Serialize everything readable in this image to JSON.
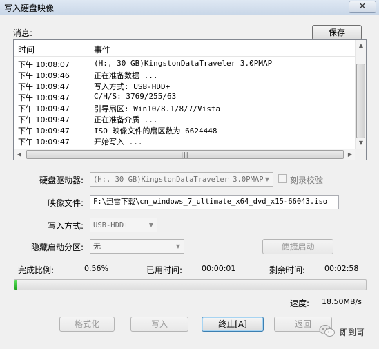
{
  "window": {
    "title": "写入硬盘映像",
    "close_symbol": "✕"
  },
  "messages": {
    "label": "消息:",
    "save_button": "保存",
    "columns": [
      "时间",
      "事件"
    ],
    "rows": [
      {
        "time": "下午 10:08:07",
        "event": "(H:, 30 GB)KingstonDataTraveler 3.0PMAP"
      },
      {
        "time": "下午 10:09:46",
        "event": "正在准备数据 ..."
      },
      {
        "time": "下午 10:09:47",
        "event": "写入方式: USB-HDD+"
      },
      {
        "time": "下午 10:09:47",
        "event": "C/H/S: 3769/255/63"
      },
      {
        "time": "下午 10:09:47",
        "event": "引导扇区: Win10/8.1/8/7/Vista"
      },
      {
        "time": "下午 10:09:47",
        "event": "正在准备介质 ..."
      },
      {
        "time": "下午 10:09:47",
        "event": "ISO 映像文件的扇区数为 6624448"
      },
      {
        "time": "下午 10:09:47",
        "event": "开始写入 ..."
      }
    ]
  },
  "form": {
    "drive_label": "硬盘驱动器:",
    "drive_value": "(H:, 30 GB)KingstonDataTraveler 3.0PMAP",
    "verify_label": "刻录校验",
    "image_label": "映像文件:",
    "image_value": "F:\\迅雷下载\\cn_windows_7_ultimate_x64_dvd_x15-66043.iso",
    "write_mode_label": "写入方式:",
    "write_mode_value": "USB-HDD+",
    "hidden_partition_label": "隐藏启动分区:",
    "hidden_partition_value": "无",
    "quick_boot_button": "便捷启动"
  },
  "status": {
    "progress_label": "完成比例:",
    "progress_value": "0.56%",
    "progress_fraction": 0.0056,
    "elapsed_label": "已用时间:",
    "elapsed_value": "00:00:01",
    "remaining_label": "剩余时间:",
    "remaining_value": "00:02:58",
    "speed_label": "速度:",
    "speed_value": "18.50MB/s"
  },
  "buttons": {
    "format": "格式化",
    "write": "写入",
    "stop": "终止[A]",
    "back": "返回"
  },
  "watermark": {
    "text": "即到哥"
  },
  "colors": {
    "progress_fill": "#2fbf2f",
    "title_bar": "#d4e0ee"
  }
}
